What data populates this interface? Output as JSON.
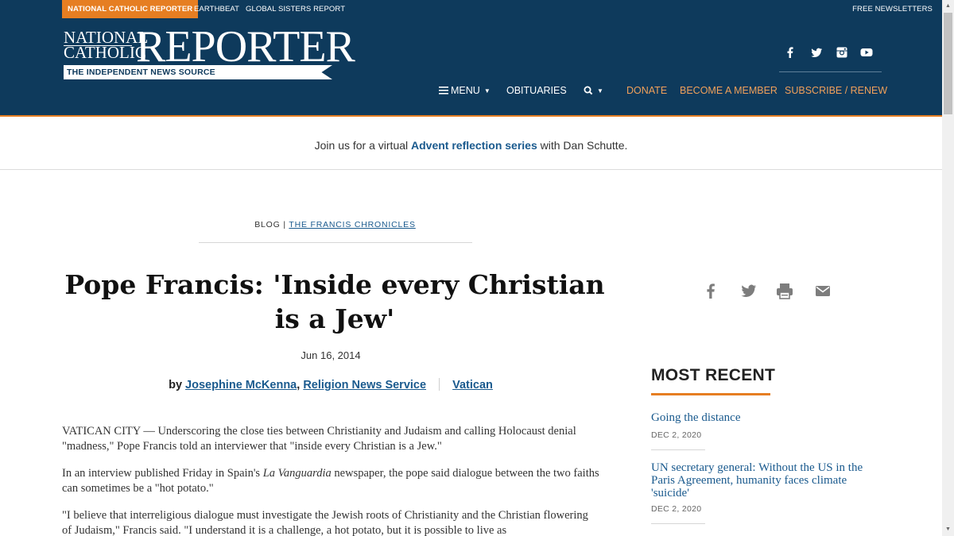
{
  "topbar": {
    "active": "NATIONAL CATHOLIC REPORTER",
    "earthbeat": "EARTHBEAT",
    "gsr": "GLOBAL SISTERS REPORT",
    "newsletters": "FREE NEWSLETTERS"
  },
  "header": {
    "logo_national": "NATIONAL",
    "logo_catholic": "CATHOLIC",
    "logo_reporter": "REPORTER",
    "tagline": "THE INDEPENDENT NEWS SOURCE",
    "social": [
      "facebook-icon",
      "twitter-icon",
      "instagram-icon",
      "youtube-icon"
    ],
    "nav": {
      "menu": "MENU",
      "obituaries": "OBITUARIES",
      "search_caret": "▾",
      "donate": "DONATE",
      "member": "BECOME A MEMBER",
      "subscribe": "SUBSCRIBE / RENEW"
    }
  },
  "promo": {
    "before": "Join us for a virtual ",
    "link": "Advent reflection series",
    "after": " with Dan Schutte."
  },
  "article": {
    "kicker_blog": "BLOG",
    "kicker_sep": "|",
    "kicker_link": "THE FRANCIS CHRONICLES",
    "headline": "Pope Francis: 'Inside every Christian is a Jew'",
    "date": "Jun 16, 2014",
    "byline_by": "by",
    "author": "Josephine McKenna",
    "comma": ",",
    "source": "Religion News Service",
    "topic": "Vatican",
    "p1_dateline": "VATICAN CITY",
    "p1_text": " — Underscoring the close ties between Christianity and Judaism and calling Holocaust denial \"madness,\" Pope Francis told an interviewer that \"inside every Christian is a Jew.\"",
    "p2_before": "In an interview published Friday in Spain's ",
    "p2_em": "La Vanguardia",
    "p2_after": " newspaper, the pope said dialogue between the two faiths can sometimes be a \"hot potato.\"",
    "p3_text": "\"I believe that interreligious dialogue must investigate the Jewish roots of Christianity and the Christian flowering of Judaism,\" Francis said. \"I understand it is a challenge, a hot potato, but it is possible to live as"
  },
  "share": [
    "facebook-icon",
    "twitter-icon",
    "print-icon",
    "email-icon"
  ],
  "sidebar": {
    "title": "MOST RECENT",
    "items": [
      {
        "title": "Going the distance",
        "date": "DEC 2, 2020"
      },
      {
        "title": "UN secretary general: Without the US in the Paris Agreement, humanity faces climate 'suicide'",
        "date": "DEC 2, 2020"
      }
    ]
  },
  "colors": {
    "navy": "#0e3a5c",
    "accent": "#e67e22",
    "link": "#1a5a8e"
  }
}
